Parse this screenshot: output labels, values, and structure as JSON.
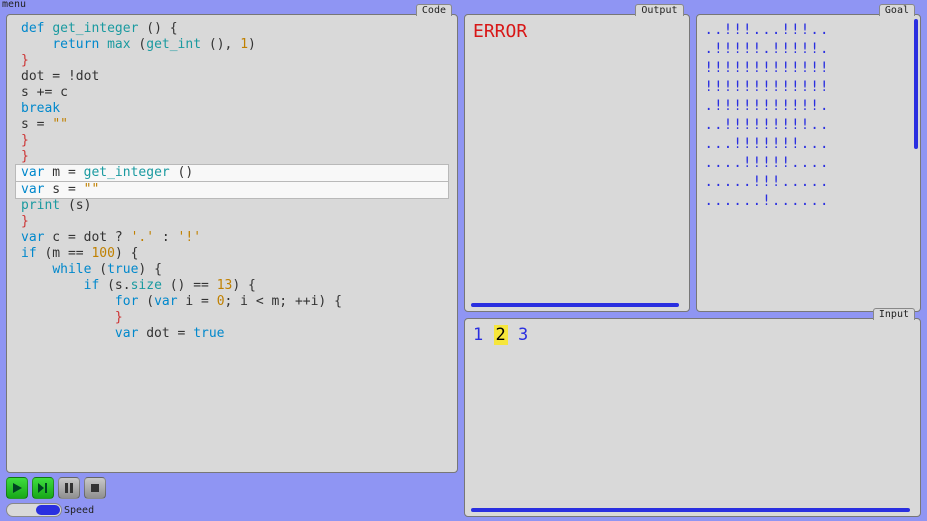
{
  "labels": {
    "menu": "menu",
    "code": "Code",
    "output": "Output",
    "goal": "Goal",
    "input": "Input",
    "speed": "Speed"
  },
  "output": {
    "text": "ERROR"
  },
  "goal": {
    "lines": [
      "..!!!...!!!..",
      ".!!!!!.!!!!!.",
      "!!!!!!!!!!!!!",
      "!!!!!!!!!!!!!",
      ".!!!!!!!!!!!.",
      "..!!!!!!!!!..",
      "...!!!!!!!...",
      "....!!!!!....",
      ".....!!!.....",
      "......!......"
    ]
  },
  "input": {
    "tokens": [
      "1",
      "2",
      "3"
    ],
    "highlight_index": 1
  },
  "code": [
    {
      "hl": false,
      "tokens": [
        [
          "kw2",
          "def"
        ],
        [
          " "
        ],
        [
          "tealname",
          "get_integer"
        ],
        [
          " ("
        ],
        [
          ") {"
        ]
      ]
    },
    {
      "hl": false,
      "tokens": [
        [
          "",
          "    "
        ],
        [
          "kw2",
          "return"
        ],
        [
          " "
        ],
        [
          "tealname",
          "max"
        ],
        [
          " ("
        ],
        [
          "tealname",
          "get_int"
        ],
        [
          " (), "
        ],
        [
          "num",
          "1"
        ],
        [
          ")"
        ]
      ]
    },
    {
      "hl": false,
      "tokens": [
        [
          "brace",
          "}"
        ]
      ]
    },
    {
      "hl": false,
      "tokens": [
        [
          "",
          ""
        ]
      ]
    },
    {
      "hl": false,
      "tokens": [
        [
          "",
          "dot = !dot"
        ]
      ]
    },
    {
      "hl": false,
      "tokens": [
        [
          "",
          "s += c"
        ]
      ]
    },
    {
      "hl": false,
      "tokens": [
        [
          "kw2",
          "break"
        ]
      ]
    },
    {
      "hl": false,
      "tokens": [
        [
          "",
          "s = "
        ],
        [
          "str",
          "\"\""
        ]
      ]
    },
    {
      "hl": false,
      "tokens": [
        [
          "brace",
          "}"
        ]
      ]
    },
    {
      "hl": false,
      "tokens": [
        [
          "brace",
          "}"
        ]
      ]
    },
    {
      "hl": true,
      "tokens": [
        [
          "kw2",
          "var"
        ],
        [
          " m = "
        ],
        [
          "tealname",
          "get_integer"
        ],
        [
          " ()"
        ]
      ]
    },
    {
      "hl": true,
      "tokens": [
        [
          "kw2",
          "var"
        ],
        [
          " s = "
        ],
        [
          "str",
          "\"\""
        ]
      ]
    },
    {
      "hl": false,
      "tokens": [
        [
          "tealname",
          "print"
        ],
        [
          " (s)"
        ]
      ]
    },
    {
      "hl": false,
      "tokens": [
        [
          "brace",
          "}"
        ]
      ]
    },
    {
      "hl": false,
      "tokens": [
        [
          "kw2",
          "var"
        ],
        [
          " c = dot ? "
        ],
        [
          "str",
          "'.'"
        ],
        [
          " : "
        ],
        [
          "str",
          "'!'"
        ]
      ]
    },
    {
      "hl": false,
      "tokens": [
        [
          "kw2",
          "if"
        ],
        [
          " (m == "
        ],
        [
          "num",
          "100"
        ],
        [
          ") {"
        ]
      ]
    },
    {
      "hl": false,
      "tokens": [
        [
          "",
          "    "
        ],
        [
          "kw2",
          "while"
        ],
        [
          " ("
        ],
        [
          "kw2",
          "true"
        ],
        [
          ") {"
        ]
      ]
    },
    {
      "hl": false,
      "tokens": [
        [
          "",
          "        "
        ],
        [
          "kw2",
          "if"
        ],
        [
          " (s."
        ],
        [
          "tealname",
          "size"
        ],
        [
          " () == "
        ],
        [
          "num",
          "13"
        ],
        [
          ") {"
        ]
      ]
    },
    {
      "hl": false,
      "tokens": [
        [
          "",
          "            "
        ],
        [
          "kw2",
          "for"
        ],
        [
          " ("
        ],
        [
          "kw2",
          "var"
        ],
        [
          " i = "
        ],
        [
          "num",
          "0"
        ],
        [
          "; i < m; ++i) {"
        ]
      ]
    },
    {
      "hl": false,
      "tokens": [
        [
          "",
          "            "
        ],
        [
          "brace",
          "}"
        ]
      ]
    },
    {
      "hl": false,
      "tokens": [
        [
          "",
          "            "
        ],
        [
          "kw2",
          "var"
        ],
        [
          " dot = "
        ],
        [
          "kw2",
          "true"
        ]
      ]
    }
  ],
  "icons": {
    "play": "play-icon",
    "step": "step-icon",
    "pause": "pause-icon",
    "stop": "stop-icon"
  }
}
